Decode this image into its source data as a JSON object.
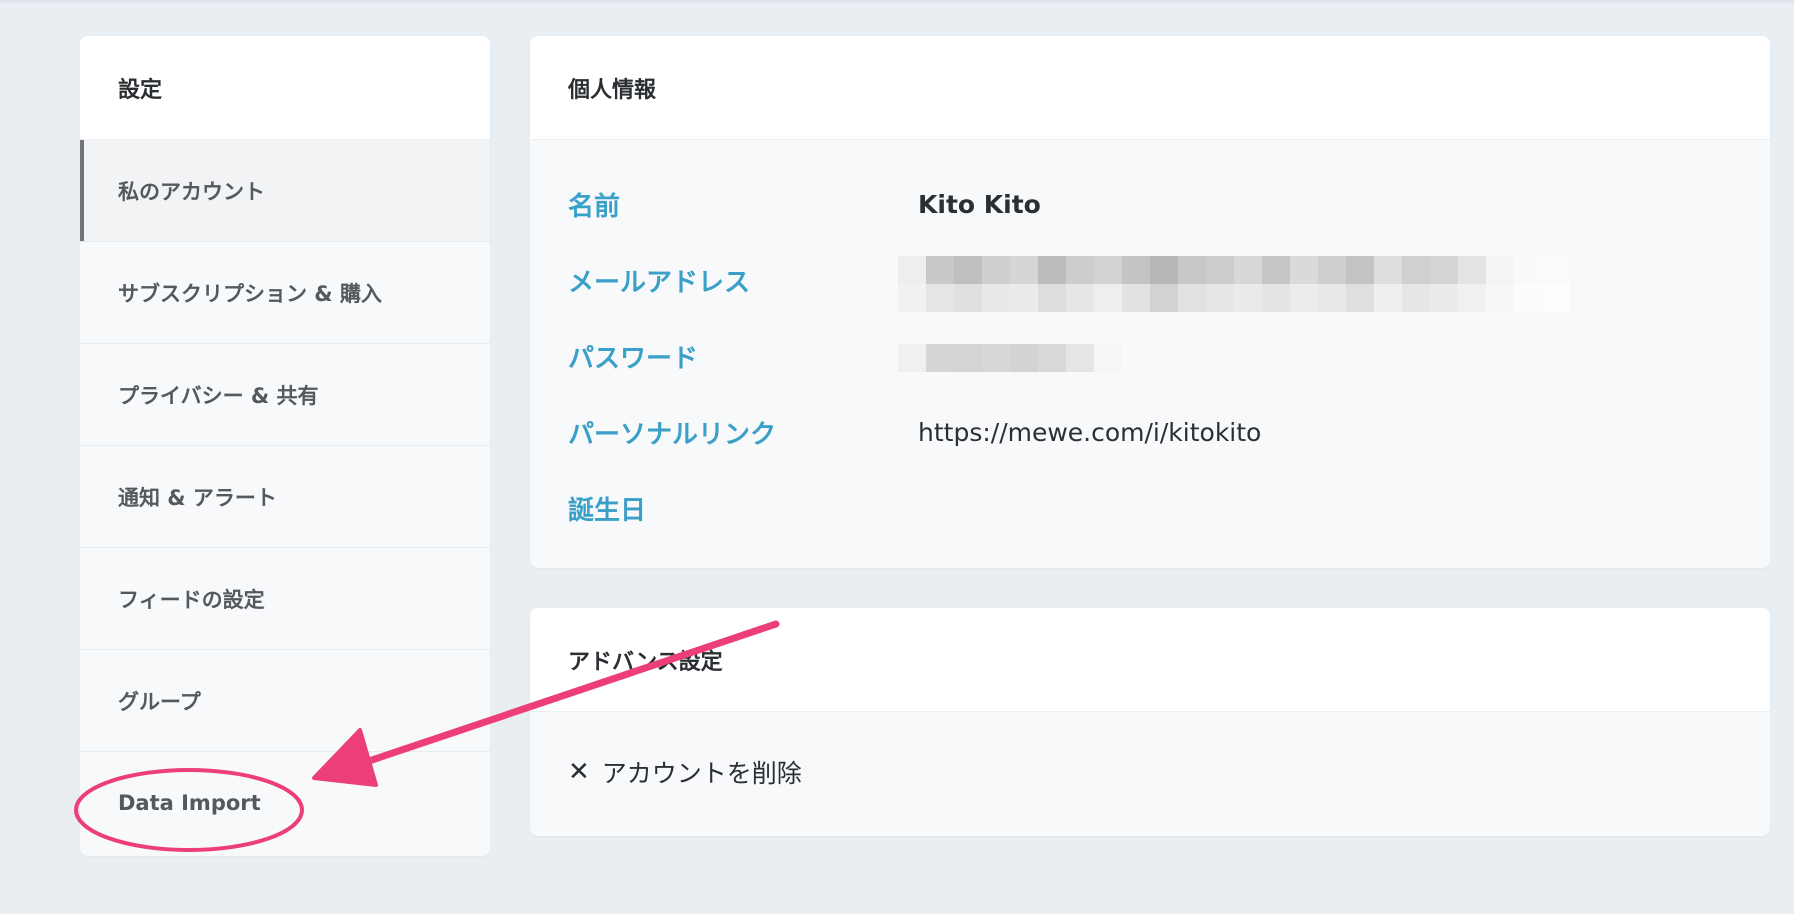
{
  "sidebar": {
    "title": "設定",
    "items": [
      {
        "label": "私のアカウント",
        "active": true
      },
      {
        "label": "サブスクリプション & 購入"
      },
      {
        "label": "プライバシー & 共有"
      },
      {
        "label": "通知 & アラート"
      },
      {
        "label": "フィードの設定"
      },
      {
        "label": "グループ"
      },
      {
        "label": "Data Import"
      }
    ]
  },
  "personal": {
    "title": "個人情報",
    "rows": [
      {
        "label": "名前",
        "value": "Kito Kito"
      },
      {
        "label": "メールアドレス",
        "value": ""
      },
      {
        "label": "パスワード",
        "value": ""
      },
      {
        "label": "パーソナルリンク",
        "value": "https://mewe.com/i/kitokito"
      },
      {
        "label": "誕生日",
        "value": ""
      }
    ]
  },
  "advanced": {
    "title": "アドバンス設定",
    "delete_icon": "close-icon",
    "delete_label": "アカウントを削除"
  },
  "colors": {
    "accent": "#3aa0c8",
    "annotation": "#ec3f78",
    "background": "#e9eef2"
  }
}
